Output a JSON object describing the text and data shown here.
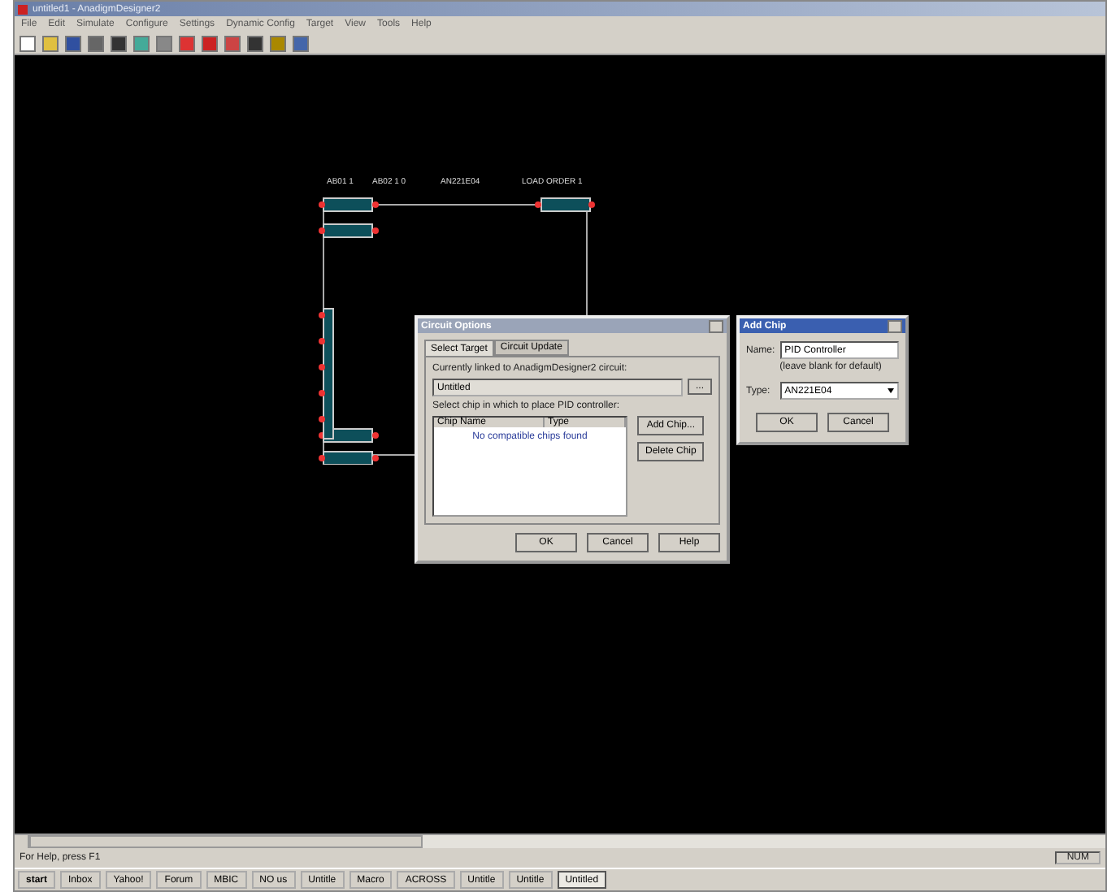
{
  "window": {
    "title": "untitled1 - AnadigmDesigner2"
  },
  "menu": [
    "File",
    "Edit",
    "Simulate",
    "Configure",
    "Settings",
    "Dynamic Config",
    "Target",
    "View",
    "Tools",
    "Help"
  ],
  "canvas": {
    "chip_labels": [
      "AB01 1",
      "AB02 1 0",
      "AN221E04",
      "LOAD ORDER 1"
    ]
  },
  "circuit_options": {
    "title": "Circuit Options",
    "tabs": [
      {
        "label": "Select Target",
        "selected": true
      },
      {
        "label": "Circuit Update",
        "selected": false
      }
    ],
    "linked_label": "Currently linked to AnadigmDesigner2 circuit:",
    "linked_value": "Untitled",
    "browse": "...",
    "select_label": "Select chip in which to place PID controller:",
    "columns": [
      "Chip Name",
      "Type"
    ],
    "empty_message": "No compatible chips found",
    "side_buttons": [
      "Add Chip...",
      "Delete Chip"
    ],
    "buttons": [
      "OK",
      "Cancel",
      "Help"
    ]
  },
  "add_chip": {
    "title": "Add Chip",
    "name_label": "Name:",
    "name_value": "PID Controller",
    "hint": "(leave blank for default)",
    "type_label": "Type:",
    "type_value": "AN221E04",
    "buttons": [
      "OK",
      "Cancel"
    ]
  },
  "status_bar": {
    "text": "For Help, press F1",
    "indicator": "NUM"
  },
  "taskbar": {
    "start": "start",
    "tasks": [
      {
        "label": "Inbox",
        "selected": false
      },
      {
        "label": "Yahoo!",
        "selected": false
      },
      {
        "label": "Forum",
        "selected": false
      },
      {
        "label": "MBIC",
        "selected": false
      },
      {
        "label": "NO us",
        "selected": false
      },
      {
        "label": "Untitle",
        "selected": false
      },
      {
        "label": "Macro",
        "selected": false
      },
      {
        "label": "ACROSS",
        "selected": false
      },
      {
        "label": "Untitle",
        "selected": false
      },
      {
        "label": "Untitle",
        "selected": false
      },
      {
        "label": "Untitled",
        "selected": true
      }
    ]
  }
}
